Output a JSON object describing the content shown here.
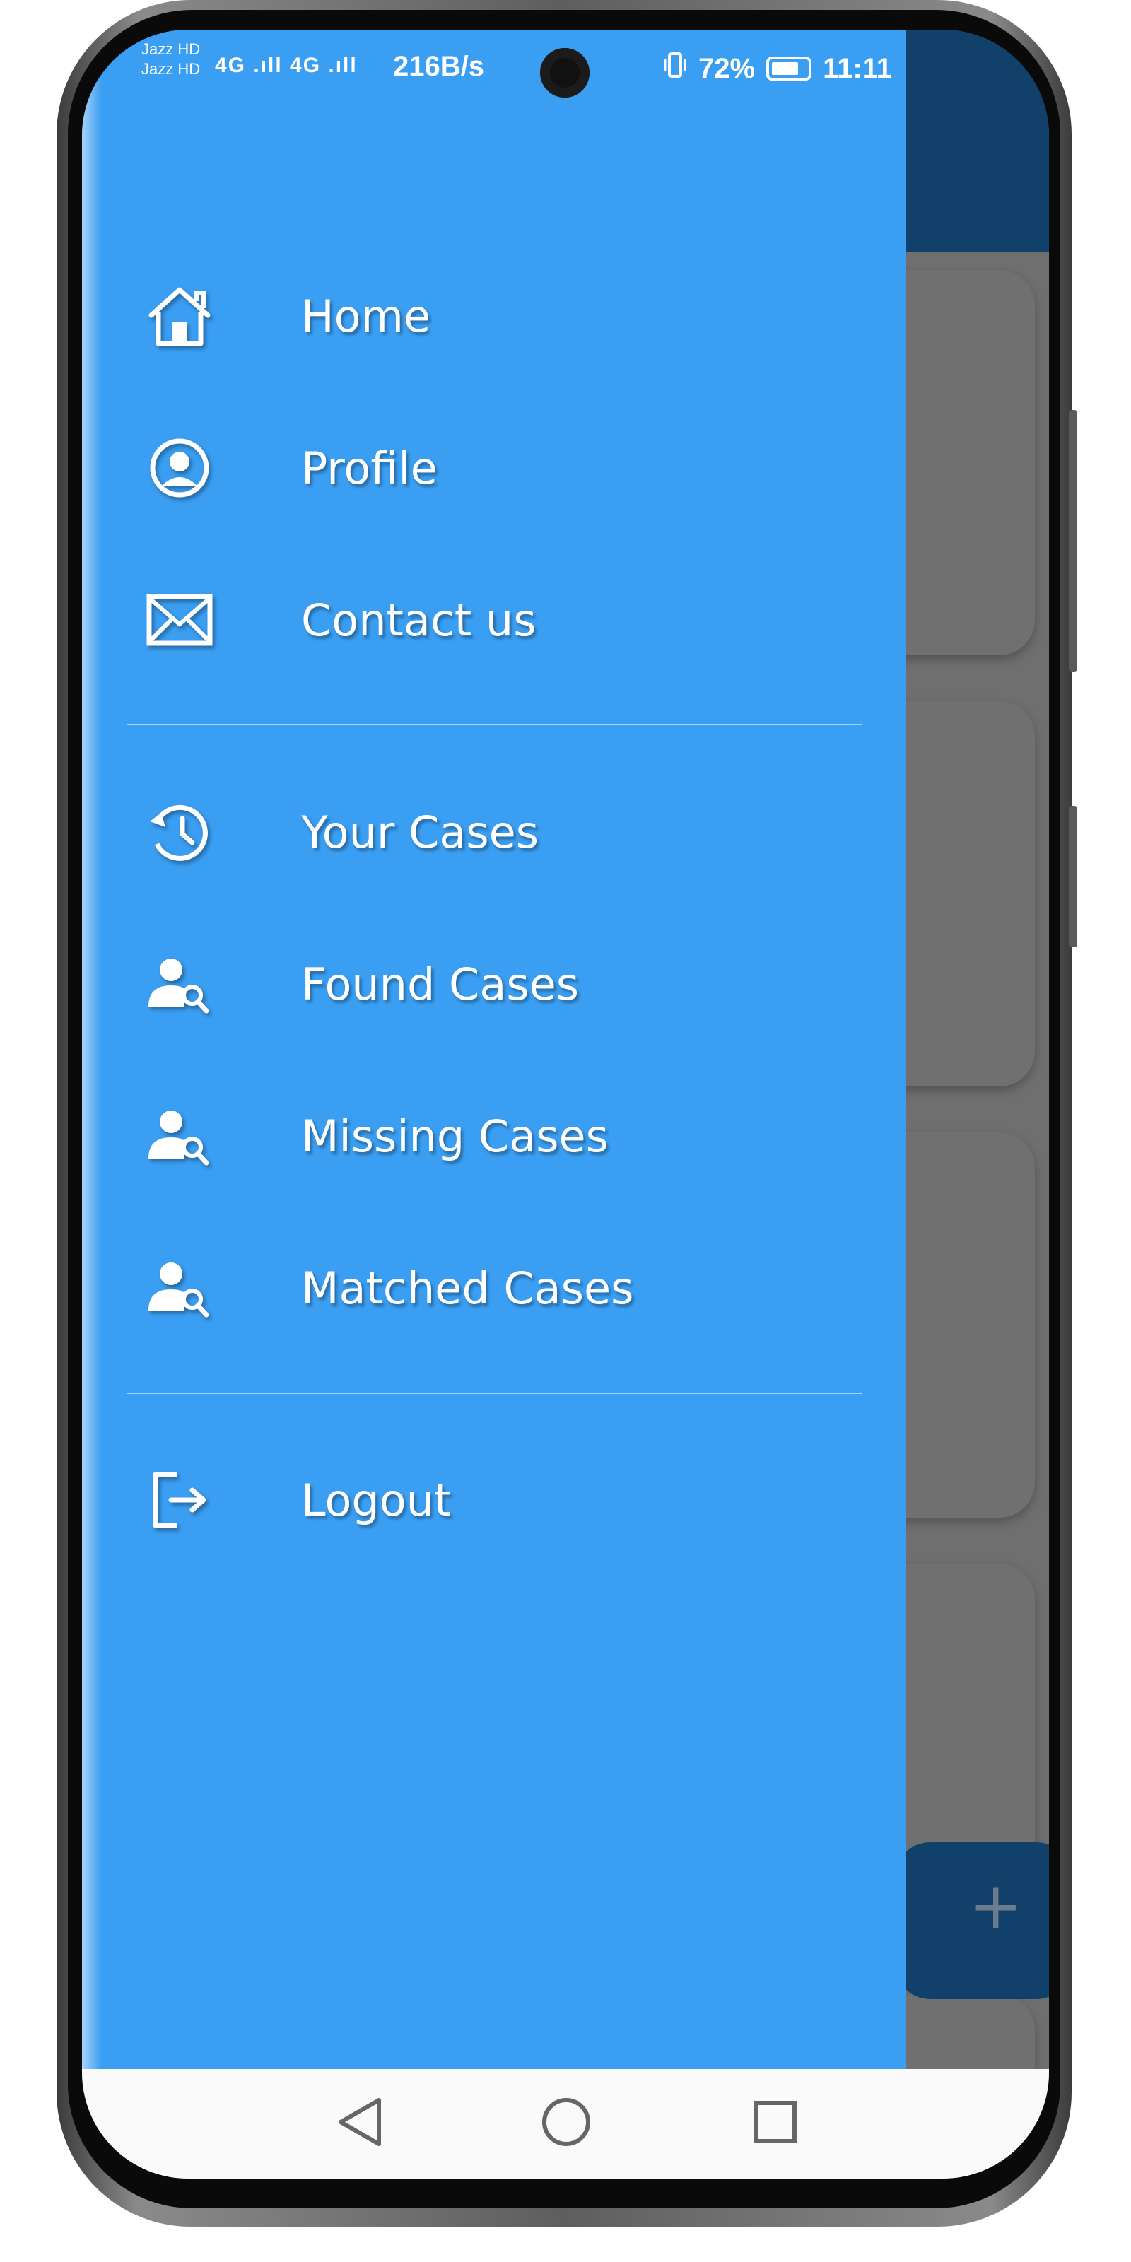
{
  "status_bar": {
    "carrier_1": "Jazz HD",
    "carrier_2": "Jazz HD",
    "signal": "4G .ıll 4G .ıll",
    "net_speed": "216B/s",
    "battery_percent": "72%",
    "time": "11:11"
  },
  "drawer": {
    "background_color": "#3a9ef2",
    "groups": [
      [
        {
          "label": "Home",
          "icon": "home-icon"
        },
        {
          "label": "Profile",
          "icon": "profile-icon"
        },
        {
          "label": "Contact us",
          "icon": "mail-icon"
        }
      ],
      [
        {
          "label": "Your Cases",
          "icon": "history-icon"
        },
        {
          "label": "Found Cases",
          "icon": "person-search-icon"
        },
        {
          "label": "Missing Cases",
          "icon": "person-search-icon"
        },
        {
          "label": "Matched Cases",
          "icon": "person-search-icon"
        }
      ],
      [
        {
          "label": "Logout",
          "icon": "logout-icon"
        }
      ]
    ]
  },
  "background_app": {
    "appbar_color": "#11416b",
    "fab_label": "+"
  },
  "nav_bar": {
    "back": "back-icon",
    "home": "home-circle-icon",
    "recents": "recents-icon"
  }
}
